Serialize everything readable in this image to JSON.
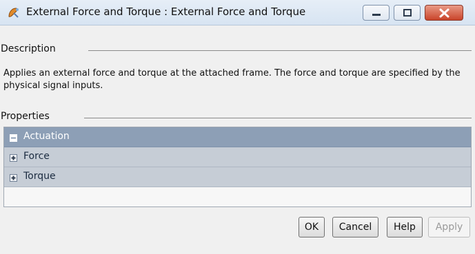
{
  "window": {
    "title": "External Force and Torque : External Force and Torque",
    "icon": "block-mask-icon"
  },
  "description": {
    "heading": "Description",
    "text": "Applies an external force and torque at the attached frame. The force and torque are specified by the physical signal inputs."
  },
  "properties": {
    "heading": "Properties",
    "rows": [
      {
        "label": "Actuation",
        "state": "expanded"
      },
      {
        "label": "Force",
        "state": "collapsed"
      },
      {
        "label": "Torque",
        "state": "collapsed"
      }
    ]
  },
  "buttons": {
    "ok": "OK",
    "cancel": "Cancel",
    "help": "Help",
    "apply": "Apply"
  },
  "colors": {
    "group_header": "#8d9fb6",
    "child_row": "#c6cdd6",
    "close_button": "#c9442a"
  }
}
